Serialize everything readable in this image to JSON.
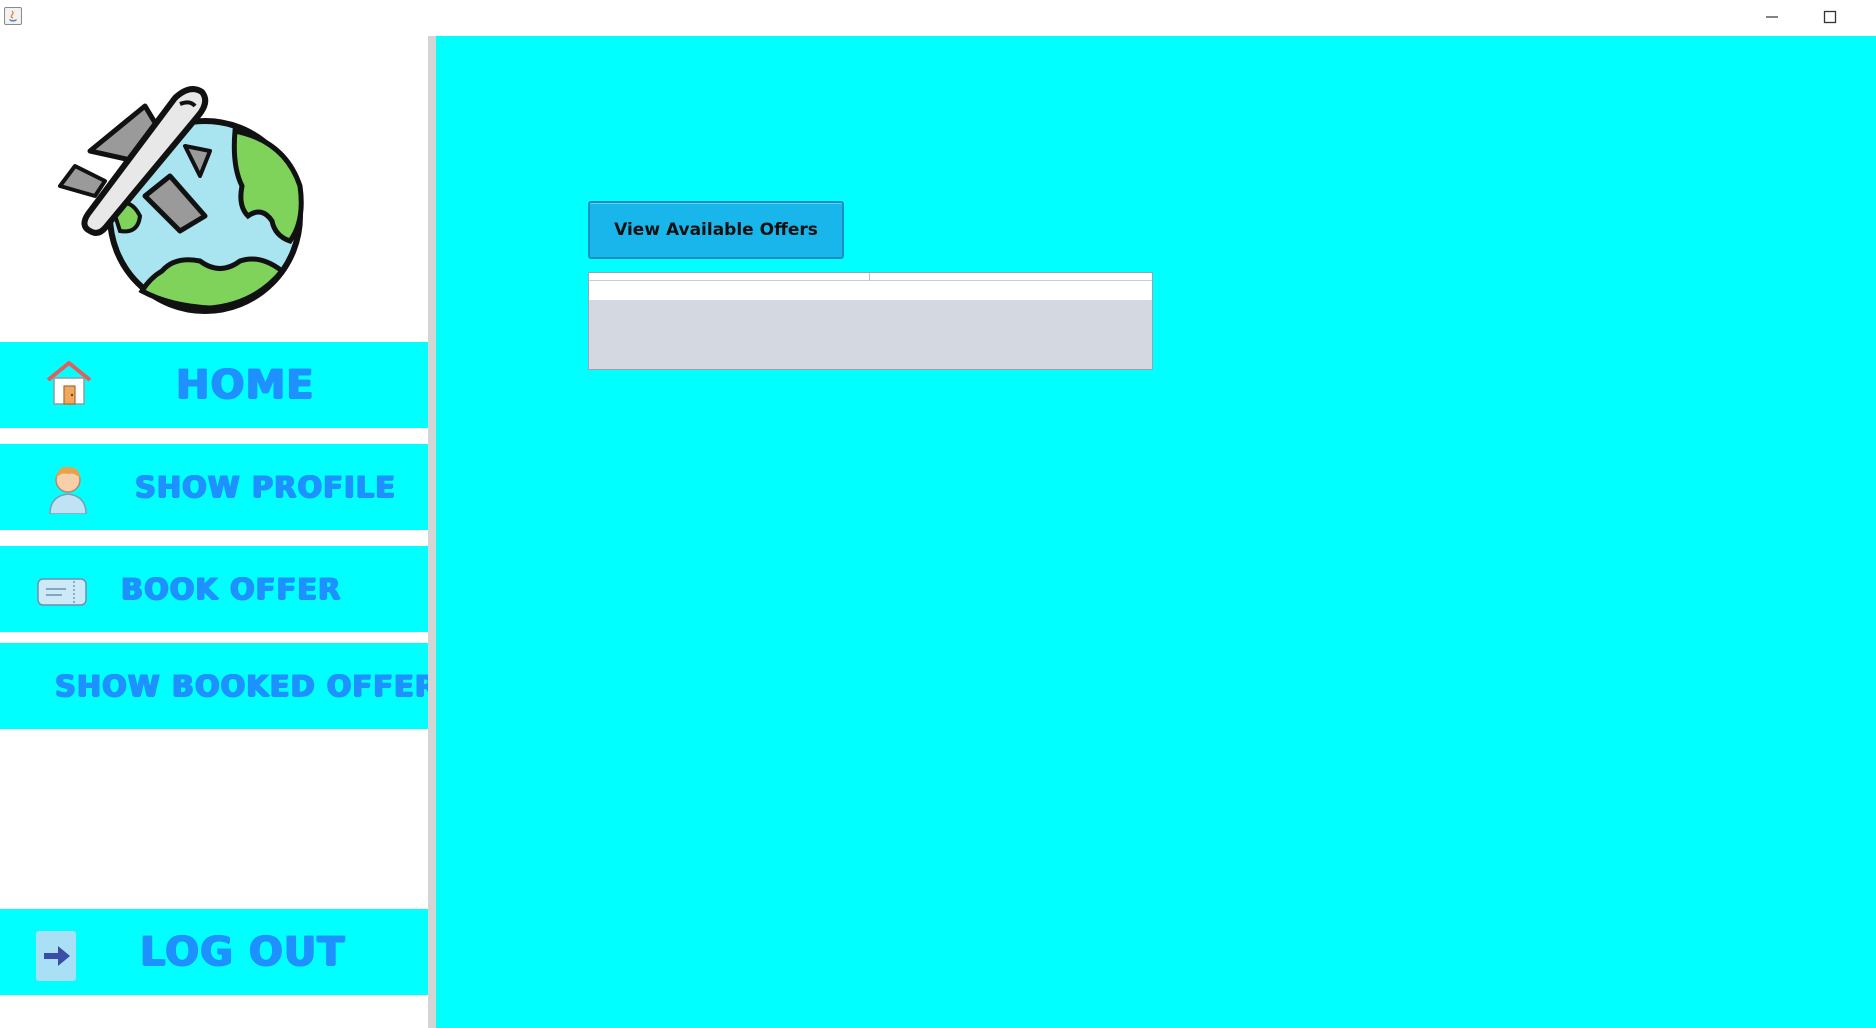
{
  "window": {
    "title": "",
    "controls": {
      "minimize_icon": "minimize-icon",
      "maximize_icon": "maximize-icon"
    }
  },
  "sidebar": {
    "logo_icon": "airplane-globe-icon",
    "nav": [
      {
        "label": "HOME",
        "icon": "house-icon"
      },
      {
        "label": "SHOW PROFILE",
        "icon": "user-icon"
      },
      {
        "label": "BOOK OFFER",
        "icon": "ticket-icon"
      },
      {
        "label": "SHOW BOOKED OFFERS",
        "icon": ""
      }
    ],
    "logout": {
      "label": "LOG OUT",
      "icon": "arrow-right-icon"
    }
  },
  "main": {
    "view_offers_label": "View Available Offers",
    "offers_table": {
      "columns": [
        "",
        ""
      ],
      "rows": [
        [
          "",
          ""
        ]
      ]
    }
  },
  "colors": {
    "accent": "#00ffff",
    "nav_text": "#1e90ff",
    "button_bg": "#19b6ec",
    "divider": "#d4d4d4",
    "table_bg": "#d4d9e1"
  }
}
